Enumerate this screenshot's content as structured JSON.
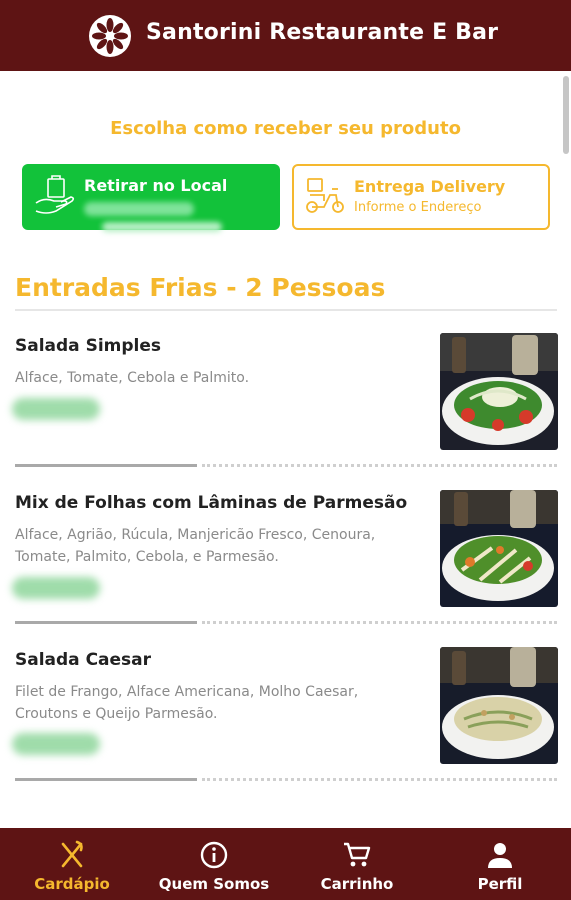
{
  "header": {
    "title": "Santorini Restaurante E Bar",
    "logo_icon": "flower-logo-icon",
    "color": "#5e1414"
  },
  "delivery_choice": {
    "prompt": "Escolha como receber seu produto",
    "pickup": {
      "title": "Retirar no Local",
      "icon": "store-pickup-icon",
      "color": "#12c23a"
    },
    "delivery": {
      "title": "Entrega Delivery",
      "subtitle": "Informe o Endereço",
      "icon": "delivery-motorbike-icon",
      "color": "#f5b82e"
    }
  },
  "section": {
    "title": "Entradas Frias - 2 Pessoas"
  },
  "items": [
    {
      "name": "Salada Simples",
      "description": "Alface, Tomate, Cebola e Palmito."
    },
    {
      "name": "Mix de Folhas com Lâminas de Parmesão",
      "description": "Alface, Agrião, Rúcula, Manjericão Fresco, Cenoura, Tomate, Palmito, Cebola, e Parmesão."
    },
    {
      "name": "Salada Caesar",
      "description": "Filet de Frango, Alface Americana, Molho Caesar, Croutons e Queijo Parmesão."
    }
  ],
  "bottom_nav": [
    {
      "label": "Cardápio",
      "icon": "fork-knife-icon",
      "active": true
    },
    {
      "label": "Quem Somos",
      "icon": "info-icon",
      "active": false
    },
    {
      "label": "Carrinho",
      "icon": "cart-icon",
      "active": false
    },
    {
      "label": "Perfil",
      "icon": "person-icon",
      "active": false
    }
  ],
  "colors": {
    "accent": "#f5b82e",
    "brand": "#5e1414",
    "green": "#12c23a"
  }
}
